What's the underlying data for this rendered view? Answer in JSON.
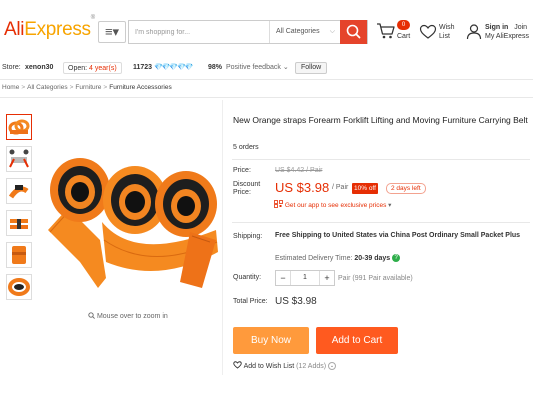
{
  "header": {
    "logo_ali": "Ali",
    "logo_express": "Express",
    "logo_mark": "®",
    "menu_icon": "≡▾",
    "search_placeholder": "I'm shopping for...",
    "category_select": "All Categories",
    "cart_count": "0",
    "cart_label": "Cart",
    "wish_label_1": "Wish",
    "wish_label_2": "List",
    "signin_label": "Sign in",
    "join_label": "Join",
    "account_label": "My AliExpress",
    "icons": [
      "menu-icon",
      "search-icon",
      "cart-icon",
      "heart-icon",
      "user-icon"
    ],
    "brand_color": "#e62e04"
  },
  "store": {
    "store_label": "Store:",
    "store_name": "xenon30",
    "open_prefix": "Open:",
    "open_years": "4 year(s)",
    "score": "11723",
    "diamonds": "💎💎💎💎💎",
    "feedback_percent": "98%",
    "feedback_label": "Positive feedback",
    "feedback_chev": "⌄",
    "follow_label": "Follow"
  },
  "breadcrumb": [
    "Home",
    "All Categories",
    "Furniture",
    "Furniture Accessories"
  ],
  "breadcrumb_sep": ">",
  "gallery": {
    "thumb_count": 6,
    "zoom_hint": "Mouse over to zoom in"
  },
  "product": {
    "title": "New Orange straps Forearm Forklift Lifting and Moving Furniture Carrying Belt",
    "orders": "5 orders",
    "price_label": "Price:",
    "old_price": "US $4.42 / Pair",
    "discount_label": "Discount Price:",
    "price": "US $3.98",
    "per_pair": "/ Pair",
    "off_badge": "10% off",
    "days_left": "2 days left",
    "app_offer": "Get our app to see exclusive prices",
    "app_offer_chev": "▾",
    "shipping_label": "Shipping:",
    "shipping_value": "Free Shipping to United States via China Post Ordinary Small Packet Plus",
    "delivery_label": "Estimated Delivery Time:",
    "delivery_days": "20-39 days",
    "delivery_help": "?",
    "quantity_label": "Quantity:",
    "qty_minus": "−",
    "quantity": "1",
    "qty_plus": "+",
    "available": "Pair (991 Pair available)",
    "total_label": "Total Price:",
    "total_value": "US $3.98",
    "buy_now": "Buy Now",
    "add_to_cart": "Add to Cart",
    "wishlist": "Add to Wish List",
    "wishlist_count": "(12 Adds)",
    "wishlist_chev": "⌄",
    "accent_color": "#ff5a1f",
    "buy_color": "#ff9a3c"
  }
}
